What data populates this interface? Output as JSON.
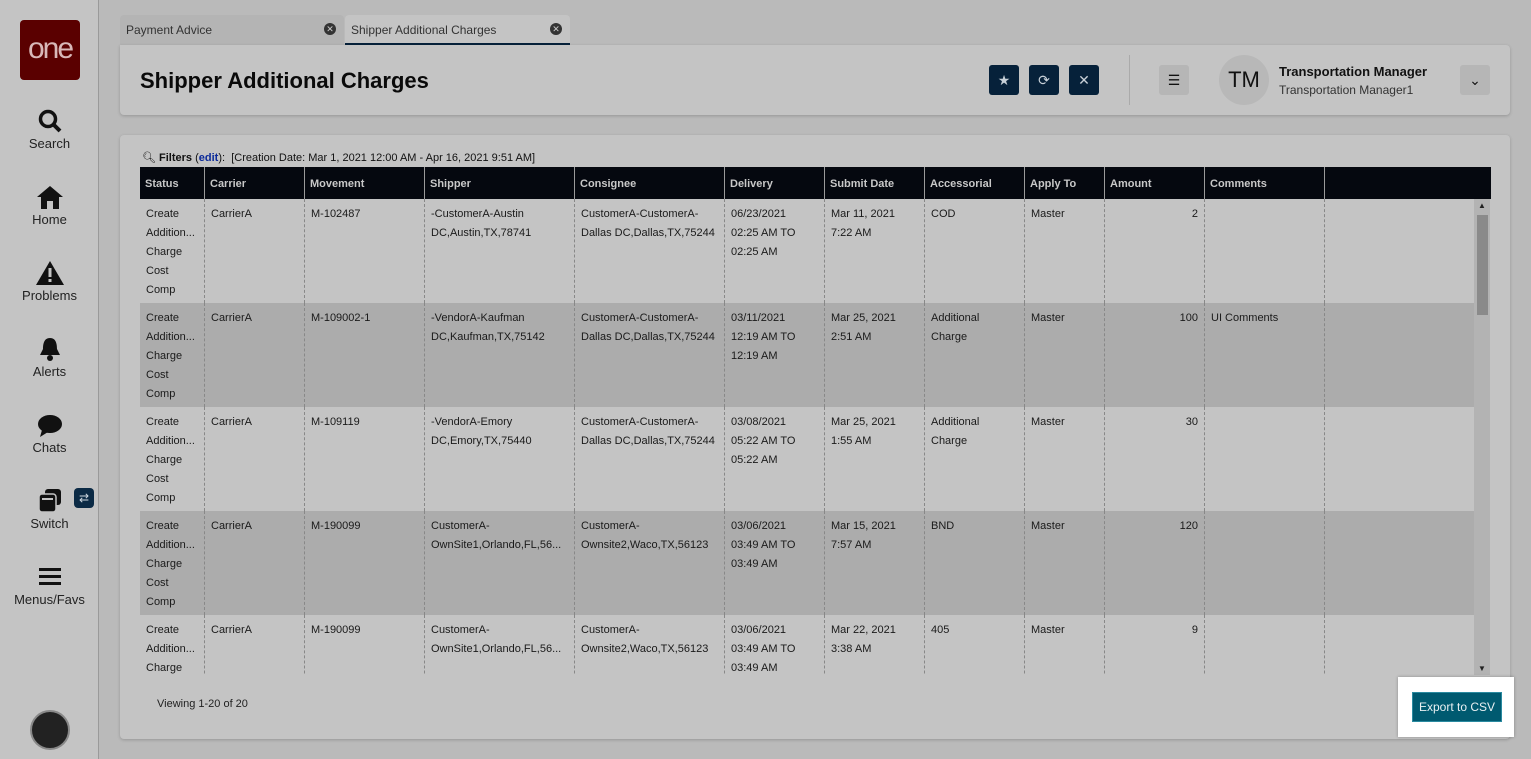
{
  "sidebar": {
    "logo": "one",
    "items": [
      {
        "label": "Search",
        "icon": "search-icon"
      },
      {
        "label": "Home",
        "icon": "home-icon"
      },
      {
        "label": "Problems",
        "icon": "warning-icon"
      },
      {
        "label": "Alerts",
        "icon": "bell-icon"
      },
      {
        "label": "Chats",
        "icon": "chat-icon"
      },
      {
        "label": "Switch",
        "icon": "switch-icon"
      },
      {
        "label": "Menus/Favs",
        "icon": "menu-icon"
      }
    ]
  },
  "tabs": [
    {
      "label": "Payment Advice"
    },
    {
      "label": "Shipper Additional Charges"
    }
  ],
  "header": {
    "title": "Shipper Additional Charges",
    "user_initials": "TM",
    "user_name": "Transportation Manager",
    "user_role": "Transportation Manager1"
  },
  "filters": {
    "label": "Filters",
    "edit": "edit",
    "value": "[Creation Date: Mar 1, 2021 12:00 AM - Apr 16, 2021 9:51 AM]"
  },
  "table": {
    "columns": [
      "Status",
      "Carrier",
      "Movement",
      "Shipper",
      "Consignee",
      "Delivery",
      "Submit Date",
      "Accessorial",
      "Apply To",
      "Amount",
      "Comments"
    ],
    "rows": [
      [
        "Create\nAddition...\nCharge\nCost\nComp",
        "CarrierA",
        "M-102487",
        "-CustomerA-Austin\nDC,Austin,TX,78741",
        "CustomerA-CustomerA-\nDallas DC,Dallas,TX,75244",
        "06/23/2021\n02:25 AM TO\n02:25 AM",
        "Mar 11, 2021\n7:22 AM",
        "COD",
        "Master",
        "2",
        ""
      ],
      [
        "Create\nAddition...\nCharge\nCost\nComp",
        "CarrierA",
        "M-109002-1",
        "-VendorA-Kaufman\nDC,Kaufman,TX,75142",
        "CustomerA-CustomerA-\nDallas DC,Dallas,TX,75244",
        "03/11/2021\n12:19 AM TO\n12:19 AM",
        "Mar 25, 2021\n2:51 AM",
        "Additional\nCharge",
        "Master",
        "100",
        "UI Comments"
      ],
      [
        "Create\nAddition...\nCharge\nCost\nComp",
        "CarrierA",
        "M-109119",
        "-VendorA-Emory\nDC,Emory,TX,75440",
        "CustomerA-CustomerA-\nDallas DC,Dallas,TX,75244",
        "03/08/2021\n05:22 AM TO\n05:22 AM",
        "Mar 25, 2021\n1:55 AM",
        "Additional\nCharge",
        "Master",
        "30",
        ""
      ],
      [
        "Create\nAddition...\nCharge\nCost\nComp",
        "CarrierA",
        "M-190099",
        "CustomerA-\nOwnSite1,Orlando,FL,56...",
        "CustomerA-\nOwnsite2,Waco,TX,56123",
        "03/06/2021\n03:49 AM TO\n03:49 AM",
        "Mar 15, 2021\n7:57 AM",
        "BND",
        "Master",
        "120",
        ""
      ],
      [
        "Create\nAddition...\nCharge\nCost\nComp",
        "CarrierA",
        "M-190099",
        "CustomerA-\nOwnSite1,Orlando,FL,56...",
        "CustomerA-\nOwnsite2,Waco,TX,56123",
        "03/06/2021\n03:49 AM TO\n03:49 AM",
        "Mar 22, 2021\n3:38 AM",
        "405",
        "Master",
        "9",
        ""
      ]
    ]
  },
  "footer": {
    "viewing": "Viewing 1-20 of 20",
    "export": "Export to CSV"
  }
}
